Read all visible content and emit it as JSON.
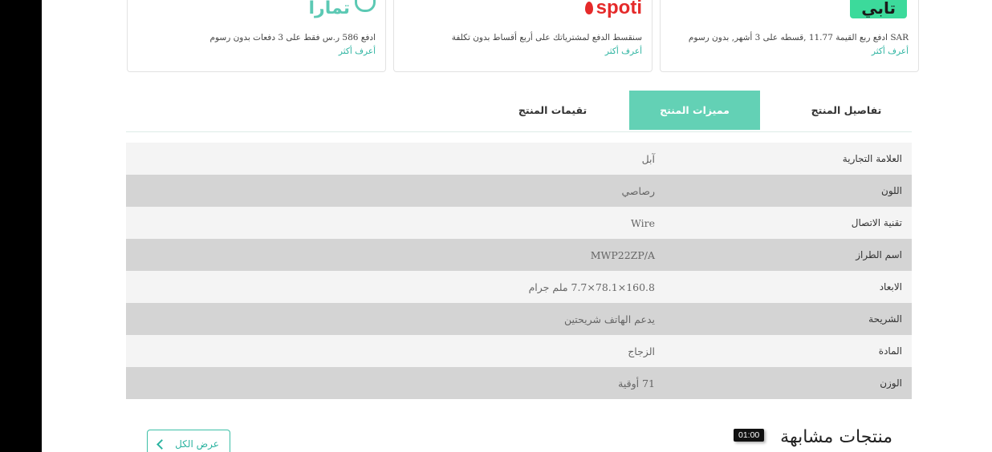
{
  "payment_cards": [
    {
      "logo_text": "تمارا",
      "description": "ادفع 586 ر.س فقط على 3 دفعات بدون رسوم",
      "link": "أعرف أكثر"
    },
    {
      "logo_text": "spoti",
      "description": "سنقسط الدفع لمشترياتك على أربع أقساط بدون تكلفة",
      "link": "أعرف أكثر"
    },
    {
      "logo_text": "تابي",
      "description": "SAR ادفع ربع القيمة 11.77 ,قسطه على 3 أشهر, بدون رسوم",
      "link": "أعرف أكثر"
    }
  ],
  "tabs": [
    {
      "label": "تفاصيل المنتج",
      "active": false
    },
    {
      "label": "مميزات المنتج",
      "active": true
    },
    {
      "label": "تقيمات المنتج",
      "active": false
    }
  ],
  "specs": [
    {
      "key": "العلامة التجارية",
      "value": "آبل"
    },
    {
      "key": "اللون",
      "value": "رصاصي"
    },
    {
      "key": "تقنية الاتصال",
      "value": "Wire"
    },
    {
      "key": "اسم الطراز",
      "value": "MWP22ZP/A"
    },
    {
      "key": "الابعاد",
      "value": "160.8×78.1×7.7 ملم جرام"
    },
    {
      "key": "الشريحة",
      "value": "يدعم الهاتف شريحتين"
    },
    {
      "key": "المادة",
      "value": "الزجاج"
    },
    {
      "key": "الوزن",
      "value": "71 أوقية"
    }
  ],
  "similar": {
    "title": "منتجات مشابهة",
    "view_all": "عرض الكل"
  },
  "timer": "01:00",
  "colors": {
    "accent": "#63d1b5",
    "link": "#2bb3a0",
    "row_odd": "#f4f4f4",
    "row_even": "#d4d4d4"
  }
}
